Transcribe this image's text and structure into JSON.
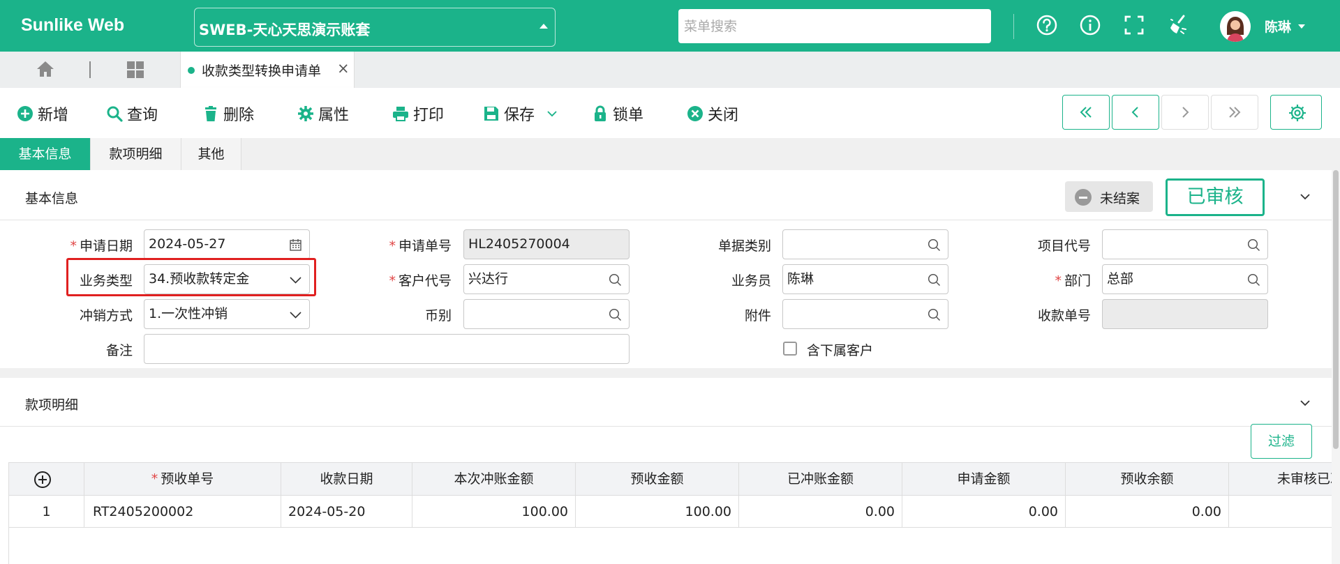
{
  "topbar": {
    "brand": "Sunlike Web",
    "account": "SWEB-天心天思演示账套",
    "menu_search_placeholder": "菜单搜索",
    "icons": [
      "help-icon",
      "info-icon",
      "fullscreen-icon",
      "clean-cache-icon"
    ],
    "user_name": "陈琳"
  },
  "tabstrip": {
    "doc_tab_label": "收款类型转换申请单",
    "close_glyph": "×"
  },
  "toolbar": {
    "add": "新增",
    "query": "查询",
    "delete": "删除",
    "properties": "属性",
    "print": "打印",
    "save": "保存",
    "lock": "锁单",
    "close": "关闭"
  },
  "subtabs": [
    "基本信息",
    "款项明细",
    "其他"
  ],
  "basic_section": {
    "title": "基本信息",
    "status_unclosed": "未结案",
    "status_audited": "已审核"
  },
  "form": {
    "apply_date": {
      "label": "申请日期",
      "value": "2024-05-27",
      "required": true
    },
    "apply_no": {
      "label": "申请单号",
      "value": "HL2405270004",
      "required": true
    },
    "doc_category": {
      "label": "单据类别",
      "value": ""
    },
    "project_code": {
      "label": "项目代号",
      "value": ""
    },
    "business_type": {
      "label": "业务类型",
      "value": "34.预收款转定金"
    },
    "customer_code": {
      "label": "客户代号",
      "value": "兴达行",
      "required": true
    },
    "salesperson": {
      "label": "业务员",
      "value": "陈琳"
    },
    "department": {
      "label": "部门",
      "value": "总部",
      "required": true
    },
    "offset_method": {
      "label": "冲销方式",
      "value": "1.一次性冲销"
    },
    "currency": {
      "label": "币别",
      "value": ""
    },
    "attachment": {
      "label": "附件",
      "value": ""
    },
    "receipt_no": {
      "label": "收款单号",
      "value": ""
    },
    "remark": {
      "label": "备注",
      "value": ""
    },
    "include_sub_customer": {
      "label": "含下属客户",
      "checked": false
    }
  },
  "detail_section": {
    "title": "款项明细",
    "filter_label": "过滤",
    "columns": [
      "预收单号",
      "收款日期",
      "本次冲账金额",
      "预收金额",
      "已冲账金额",
      "申请金额",
      "预收余额",
      "未审核已冲"
    ],
    "rows": [
      {
        "no": "1",
        "prepay_no": "RT2405200002",
        "receipt_date": "2024-05-20",
        "this_offset": "100.00",
        "prepay_amount": "100.00",
        "offset_amount": "0.00",
        "apply_amount": "0.00",
        "balance": "0.00",
        "unaudited_offset": ""
      }
    ]
  },
  "colors": {
    "brand": "#1bb38a",
    "highlight": "#e02020",
    "required": "#e04545"
  }
}
